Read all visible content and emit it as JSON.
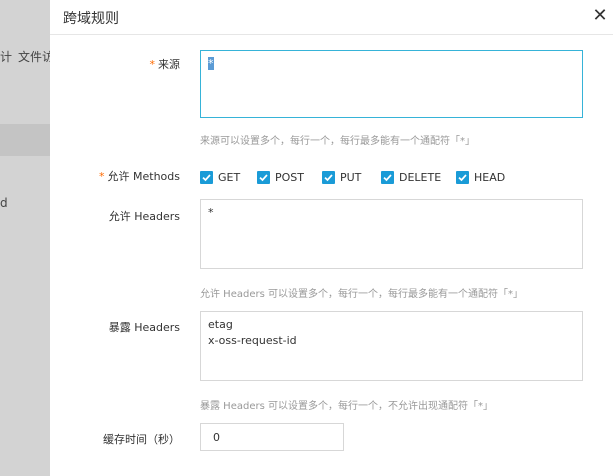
{
  "background": {
    "nav_items": [
      "计",
      "文件访"
    ],
    "side_letter": "d"
  },
  "dialog": {
    "title": "跨域规则",
    "close_glyph": "✕",
    "required_mark": "*"
  },
  "form": {
    "origin": {
      "label": "来源",
      "value": "*",
      "hint": "来源可以设置多个，每行一个，每行最多能有一个通配符「*」"
    },
    "methods": {
      "label": "允许 Methods",
      "options": [
        {
          "label": "GET",
          "checked": true
        },
        {
          "label": "POST",
          "checked": true
        },
        {
          "label": "PUT",
          "checked": true
        },
        {
          "label": "DELETE",
          "checked": true
        },
        {
          "label": "HEAD",
          "checked": true
        }
      ]
    },
    "allow_headers": {
      "label": "允许 Headers",
      "value": "*",
      "hint": "允许 Headers 可以设置多个，每行一个，每行最多能有一个通配符「*」"
    },
    "expose_headers": {
      "label": "暴露 Headers",
      "value": "etag\nx-oss-request-id",
      "hint": "暴露 Headers 可以设置多个，每行一个，不允许出现通配符「*」"
    },
    "cache_time": {
      "label": "缓存时间（秒）",
      "value": "0"
    }
  },
  "colors": {
    "accent": "#1a9bd7",
    "required": "#ff6a00",
    "focus_border": "#36b3d8"
  }
}
